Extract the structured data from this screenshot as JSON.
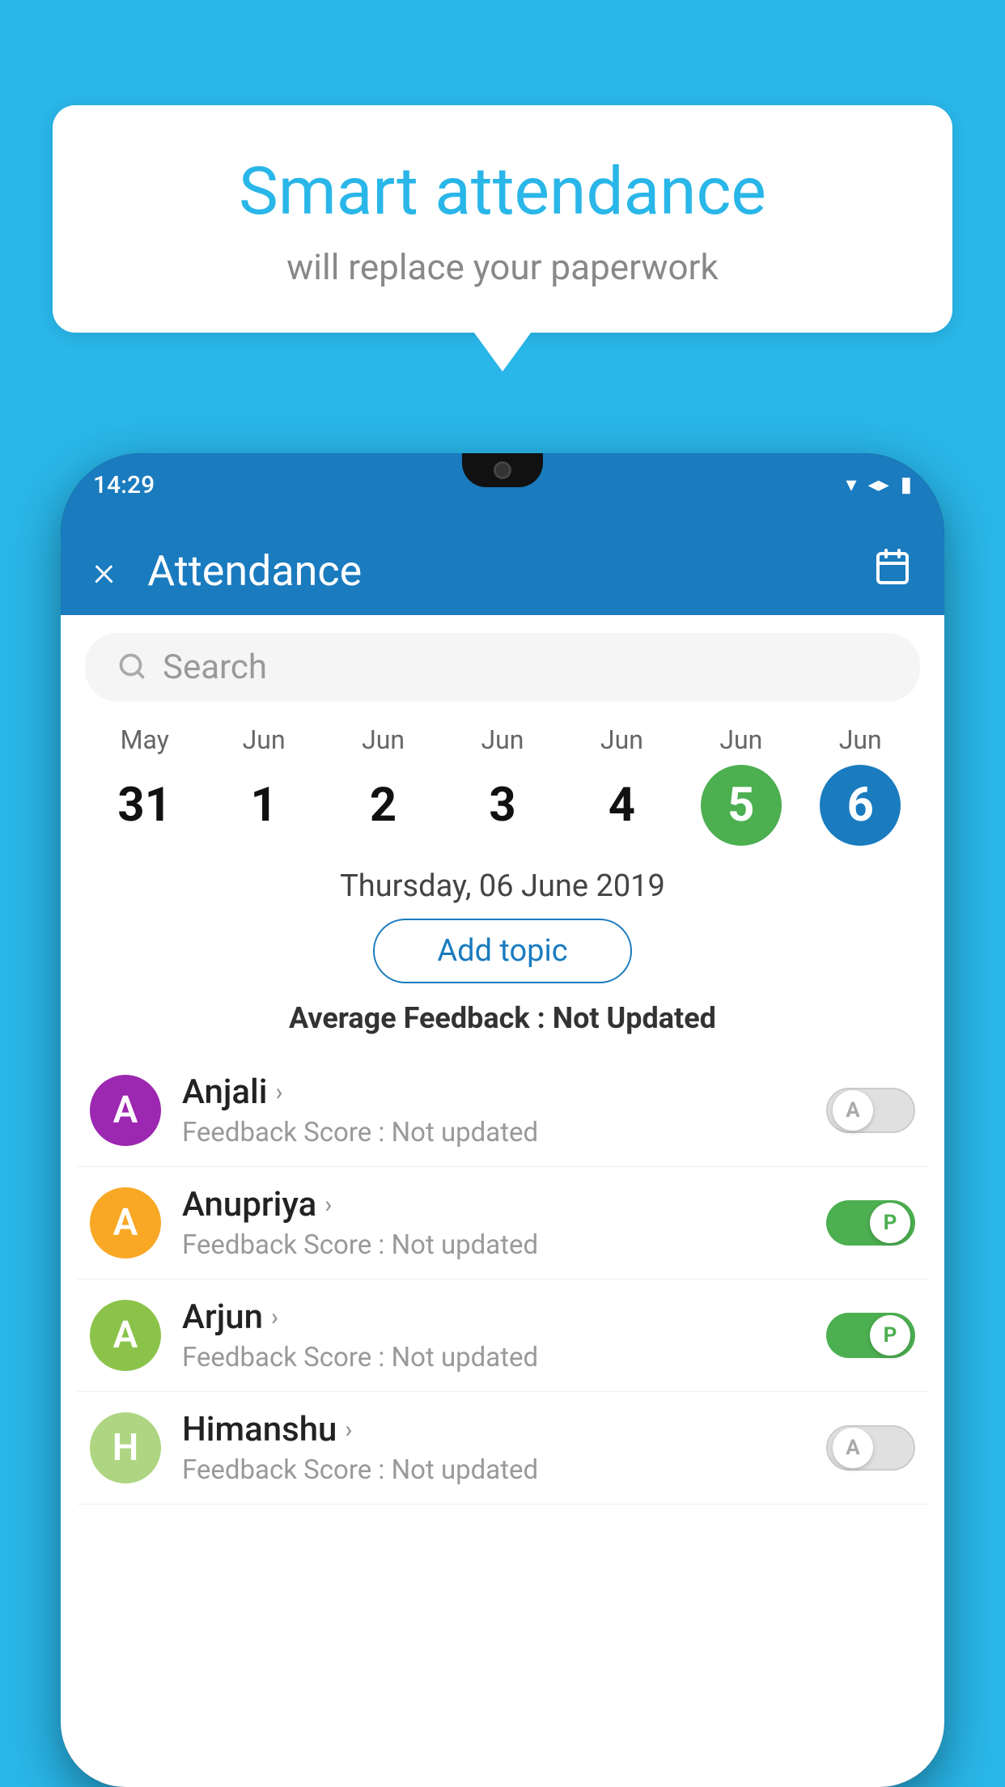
{
  "background": {
    "color": "#29b6e8"
  },
  "speech_bubble": {
    "title": "Smart attendance",
    "subtitle": "will replace your paperwork"
  },
  "status_bar": {
    "time": "14:29",
    "wifi": "wifi-icon",
    "signal": "signal-icon",
    "battery": "battery-icon"
  },
  "app_header": {
    "close_icon": "×",
    "title": "Attendance",
    "calendar_icon": "📅"
  },
  "search": {
    "placeholder": "Search"
  },
  "calendar": {
    "days": [
      {
        "month": "May",
        "date": "31",
        "style": "normal"
      },
      {
        "month": "Jun",
        "date": "1",
        "style": "normal"
      },
      {
        "month": "Jun",
        "date": "2",
        "style": "normal"
      },
      {
        "month": "Jun",
        "date": "3",
        "style": "normal"
      },
      {
        "month": "Jun",
        "date": "4",
        "style": "normal"
      },
      {
        "month": "Jun",
        "date": "5",
        "style": "today"
      },
      {
        "month": "Jun",
        "date": "6",
        "style": "selected"
      }
    ]
  },
  "selected_date": "Thursday, 06 June 2019",
  "add_topic_label": "Add topic",
  "average_feedback": {
    "label": "Average Feedback : ",
    "value": "Not Updated"
  },
  "students": [
    {
      "name": "Anjali",
      "avatar_letter": "A",
      "avatar_color": "#9c27b0",
      "feedback_label": "Feedback Score : ",
      "feedback_value": "Not updated",
      "toggle": "off",
      "toggle_letter": "A"
    },
    {
      "name": "Anupriya",
      "avatar_letter": "A",
      "avatar_color": "#f9a825",
      "feedback_label": "Feedback Score : ",
      "feedback_value": "Not updated",
      "toggle": "on",
      "toggle_letter": "P"
    },
    {
      "name": "Arjun",
      "avatar_letter": "A",
      "avatar_color": "#8bc34a",
      "feedback_label": "Feedback Score : ",
      "feedback_value": "Not updated",
      "toggle": "on",
      "toggle_letter": "P"
    },
    {
      "name": "Himanshu",
      "avatar_letter": "H",
      "avatar_color": "#aed581",
      "feedback_label": "Feedback Score : ",
      "feedback_value": "Not updated",
      "toggle": "off",
      "toggle_letter": "A"
    }
  ]
}
